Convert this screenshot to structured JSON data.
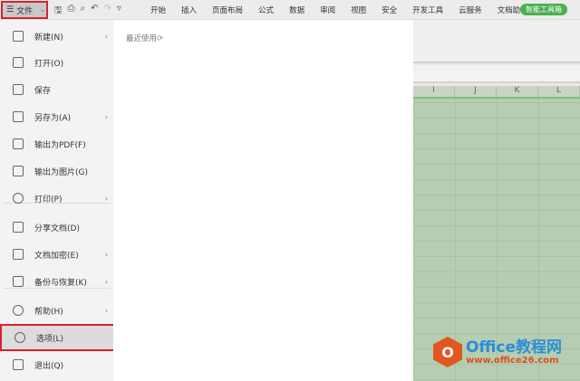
{
  "topbar": {
    "file_label": "文件",
    "tabs": [
      "开始",
      "插入",
      "页面布局",
      "公式",
      "数据",
      "审阅",
      "视图",
      "安全",
      "开发工具",
      "云服务",
      "文档助手"
    ],
    "smart_tools": "智能工具箱"
  },
  "columns": [
    "I",
    "J",
    "K",
    "L"
  ],
  "menu": [
    {
      "label": "新建(N)",
      "arrow": true
    },
    {
      "label": "打开(O)",
      "arrow": false
    },
    {
      "label": "保存",
      "arrow": false
    },
    {
      "label": "另存为(A)",
      "arrow": true
    },
    {
      "label": "输出为PDF(F)",
      "arrow": false
    },
    {
      "label": "输出为图片(G)",
      "arrow": false
    },
    {
      "label": "打印(P)",
      "arrow": true
    },
    {
      "label": "分享文档(D)",
      "arrow": false
    },
    {
      "label": "文档加密(E)",
      "arrow": true
    },
    {
      "label": "备份与恢复(K)",
      "arrow": true
    },
    {
      "label": "帮助(H)",
      "arrow": true
    },
    {
      "label": "选项(L)",
      "arrow": false
    },
    {
      "label": "退出(Q)",
      "arrow": false
    }
  ],
  "panel": {
    "recent": "最近使用"
  },
  "watermark": {
    "title": "Office教程网",
    "url": "www.office26.com"
  }
}
